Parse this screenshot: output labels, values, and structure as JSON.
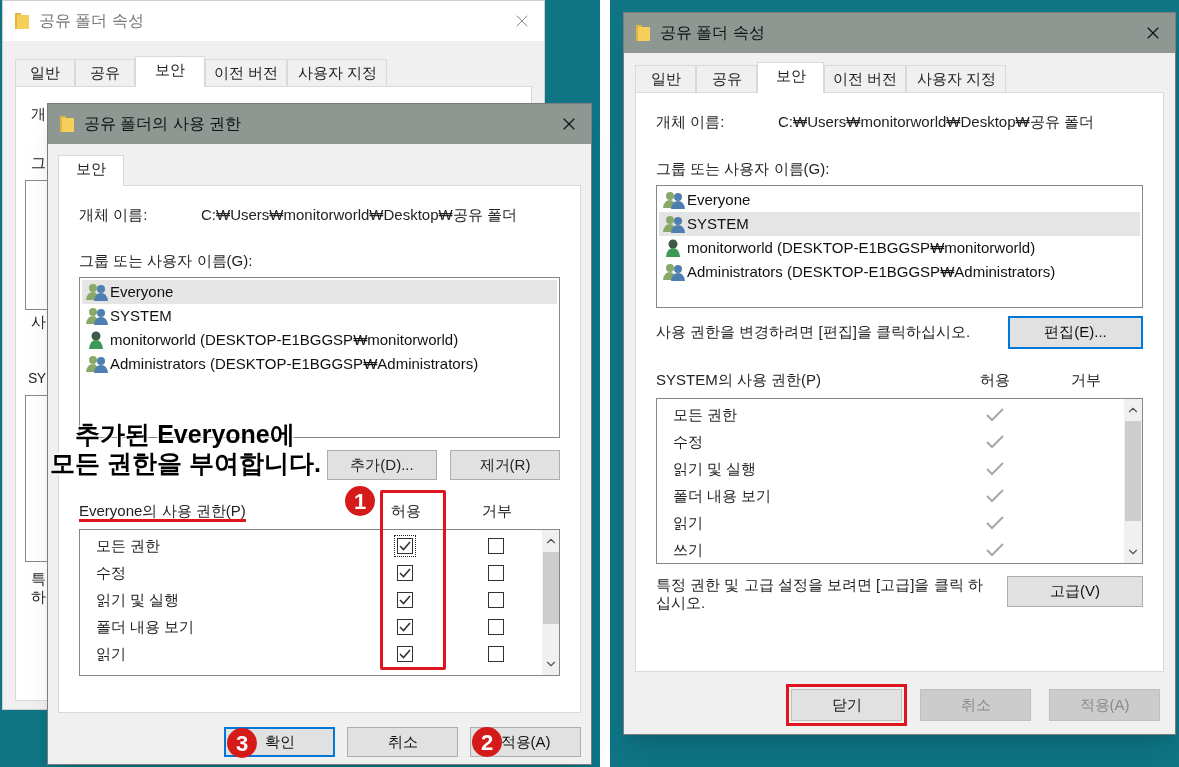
{
  "left": {
    "background_window": {
      "title": "공유 폴더 속성",
      "tabs": [
        {
          "label": "일반",
          "selected": false
        },
        {
          "label": "공유",
          "selected": false
        },
        {
          "label": "보안",
          "selected": true
        },
        {
          "label": "이전 버전",
          "selected": false
        },
        {
          "label": "사용자 지정",
          "selected": false
        }
      ],
      "fragments": [
        "개",
        "그",
        "사",
        "SY",
        "특",
        "하"
      ]
    },
    "dialog": {
      "title": "공유 폴더의 사용 권한",
      "tabs": [
        {
          "label": "보안",
          "selected": true
        }
      ],
      "object_label": "개체 이름:",
      "object_path": "C:₩Users₩monitorworld₩Desktop₩공유 폴더",
      "group_label": "그룹 또는 사용자 이름(G):",
      "principals": [
        {
          "name": "Everyone",
          "kind": "group",
          "selected": true
        },
        {
          "name": "SYSTEM",
          "kind": "group",
          "selected": false
        },
        {
          "name": "monitorworld (DESKTOP-E1BGGSP₩monitorworld)",
          "kind": "user",
          "selected": false
        },
        {
          "name": "Administrators (DESKTOP-E1BGGSP₩Administrators)",
          "kind": "group",
          "selected": false
        }
      ],
      "list_buttons": [
        "추가(D)...",
        "제거(R)"
      ],
      "permissions_label": "Everyone의 사용 권한(P)",
      "permissions_label_underlined": true,
      "columns": [
        "허용",
        "거부"
      ],
      "allow_column_marker": "1",
      "allow_column_highlighted": true,
      "permissions": [
        {
          "name": "모든 권한",
          "allow": true,
          "deny": false,
          "focused": true
        },
        {
          "name": "수정",
          "allow": true,
          "deny": false,
          "focused": false
        },
        {
          "name": "읽기 및 실행",
          "allow": true,
          "deny": false,
          "focused": false
        },
        {
          "name": "폴더 내용 보기",
          "allow": true,
          "deny": false,
          "focused": false
        },
        {
          "name": "읽기",
          "allow": true,
          "deny": false,
          "focused": false
        }
      ],
      "footer_buttons": [
        {
          "label": "확인",
          "focused": true,
          "marker": "3"
        },
        {
          "label": "취소",
          "focused": false
        },
        {
          "label": "적용(A)",
          "focused": false,
          "marker": "2"
        }
      ]
    },
    "callout": [
      "추가된 Everyone에",
      "모든 권한을 부여합니다."
    ]
  },
  "right": {
    "window": {
      "title": "공유 폴더 속성",
      "tabs": [
        {
          "label": "일반",
          "selected": false
        },
        {
          "label": "공유",
          "selected": false
        },
        {
          "label": "보안",
          "selected": true
        },
        {
          "label": "이전 버전",
          "selected": false
        },
        {
          "label": "사용자 지정",
          "selected": false
        }
      ],
      "object_label": "개체 이름:",
      "object_path": "C:₩Users₩monitorworld₩Desktop₩공유 폴더",
      "group_label": "그룹 또는 사용자 이름(G):",
      "principals": [
        {
          "name": "Everyone",
          "kind": "group",
          "selected": false
        },
        {
          "name": "SYSTEM",
          "kind": "group",
          "selected": true
        },
        {
          "name": "monitorworld (DESKTOP-E1BGGSP₩monitorworld)",
          "kind": "user",
          "selected": false
        },
        {
          "name": "Administrators (DESKTOP-E1BGGSP₩Administrators)",
          "kind": "group",
          "selected": false
        }
      ],
      "edit_hint": "사용 권한을 변경하려면 [편집]을 클릭하십시오.",
      "edit_button": {
        "label": "편집(E)...",
        "focused": true
      },
      "permissions_label": "SYSTEM의 사용 권한(P)",
      "columns": [
        "허용",
        "거부"
      ],
      "permissions": [
        {
          "name": "모든 권한",
          "allow": true
        },
        {
          "name": "수정",
          "allow": true
        },
        {
          "name": "읽기 및 실행",
          "allow": true
        },
        {
          "name": "폴더 내용 보기",
          "allow": true
        },
        {
          "name": "읽기",
          "allow": true
        },
        {
          "name": "쓰기",
          "allow": true
        }
      ],
      "advanced_hint": "특정 권한 및 고급 설정을 보려면 [고급]을 클릭 하십시오.",
      "advanced_button": "고급(V)",
      "footer_buttons": [
        {
          "label": "닫기",
          "disabled": false,
          "highlighted": true
        },
        {
          "label": "취소",
          "disabled": true,
          "highlighted": false
        },
        {
          "label": "적용(A)",
          "disabled": true,
          "highlighted": false
        }
      ]
    }
  }
}
